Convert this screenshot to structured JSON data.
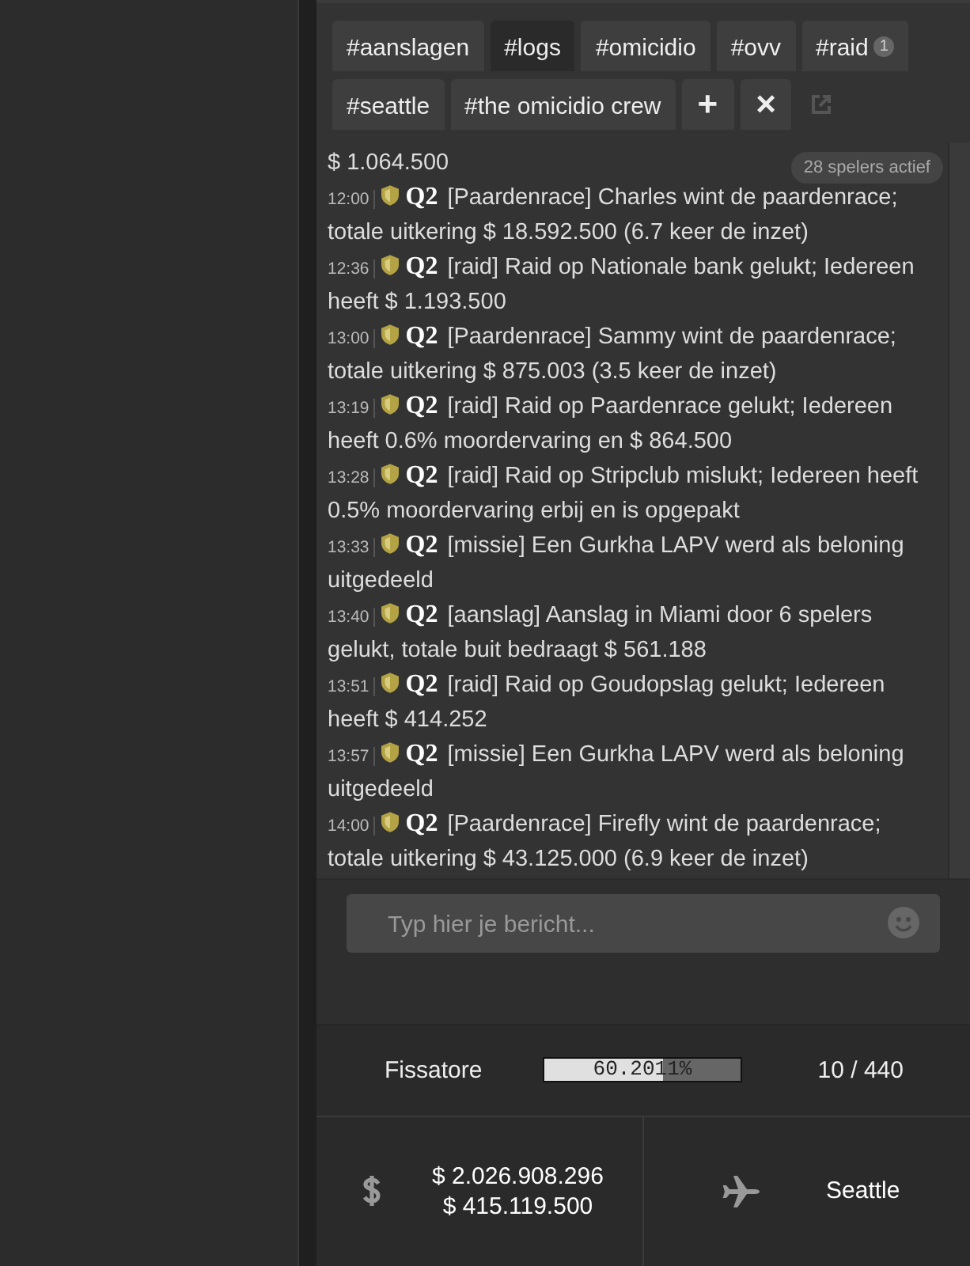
{
  "tabs": [
    {
      "label": "#aanslagen",
      "selected": false
    },
    {
      "label": "#logs",
      "selected": true
    },
    {
      "label": "#omicidio",
      "selected": false
    },
    {
      "label": "#ovv",
      "selected": false
    },
    {
      "label": "#raid",
      "selected": false,
      "badge": "1"
    },
    {
      "label": "#seattle",
      "selected": false
    },
    {
      "label": "#the omicidio crew",
      "selected": false
    }
  ],
  "add_tab": "+",
  "close_tab": "×",
  "chat": {
    "top_fragment": "$ 1.064.500",
    "players_active": "28 spelers actief",
    "messages": [
      {
        "time": "12:00",
        "author": "Q2",
        "text": "[Paardenrace] Charles wint de paardenrace; totale uitkering $ 18.592.500 (6.7 keer de inzet)"
      },
      {
        "time": "12:36",
        "author": "Q2",
        "text": "[raid] Raid op Nationale bank gelukt; Iedereen heeft $ 1.193.500"
      },
      {
        "time": "13:00",
        "author": "Q2",
        "text": "[Paardenrace] Sammy wint de paardenrace; totale uitkering $ 875.003 (3.5 keer de inzet)"
      },
      {
        "time": "13:19",
        "author": "Q2",
        "text": "[raid] Raid op Paardenrace gelukt; Iedereen heeft 0.6% moordervaring en $ 864.500"
      },
      {
        "time": "13:28",
        "author": "Q2",
        "text": "[raid] Raid op Stripclub mislukt; Iedereen heeft 0.5% moordervaring erbij en is opgepakt"
      },
      {
        "time": "13:33",
        "author": "Q2",
        "text": "[missie] Een Gurkha LAPV werd als beloning uitgedeeld"
      },
      {
        "time": "13:40",
        "author": "Q2",
        "text": "[aanslag] Aanslag in Miami door 6 spelers gelukt, totale buit bedraagt $ 561.188"
      },
      {
        "time": "13:51",
        "author": "Q2",
        "text": "[raid] Raid op Goudopslag gelukt; Iedereen heeft $ 414.252"
      },
      {
        "time": "13:57",
        "author": "Q2",
        "text": "[missie] Een Gurkha LAPV werd als beloning uitgedeeld"
      },
      {
        "time": "14:00",
        "author": "Q2",
        "text": "[Paardenrace] Firefly wint de paardenrace; totale uitkering $ 43.125.000 (6.9 keer de inzet)"
      }
    ],
    "input": {
      "placeholder": "Typ hier je bericht..."
    }
  },
  "rank": {
    "name": "Fissatore",
    "level": 0.602011,
    "reading": "60.2011%",
    "count": "10 / 440"
  },
  "money": [
    "$ 2.026.908.296",
    "$ 415.119.500"
  ],
  "location": "Seattle"
}
